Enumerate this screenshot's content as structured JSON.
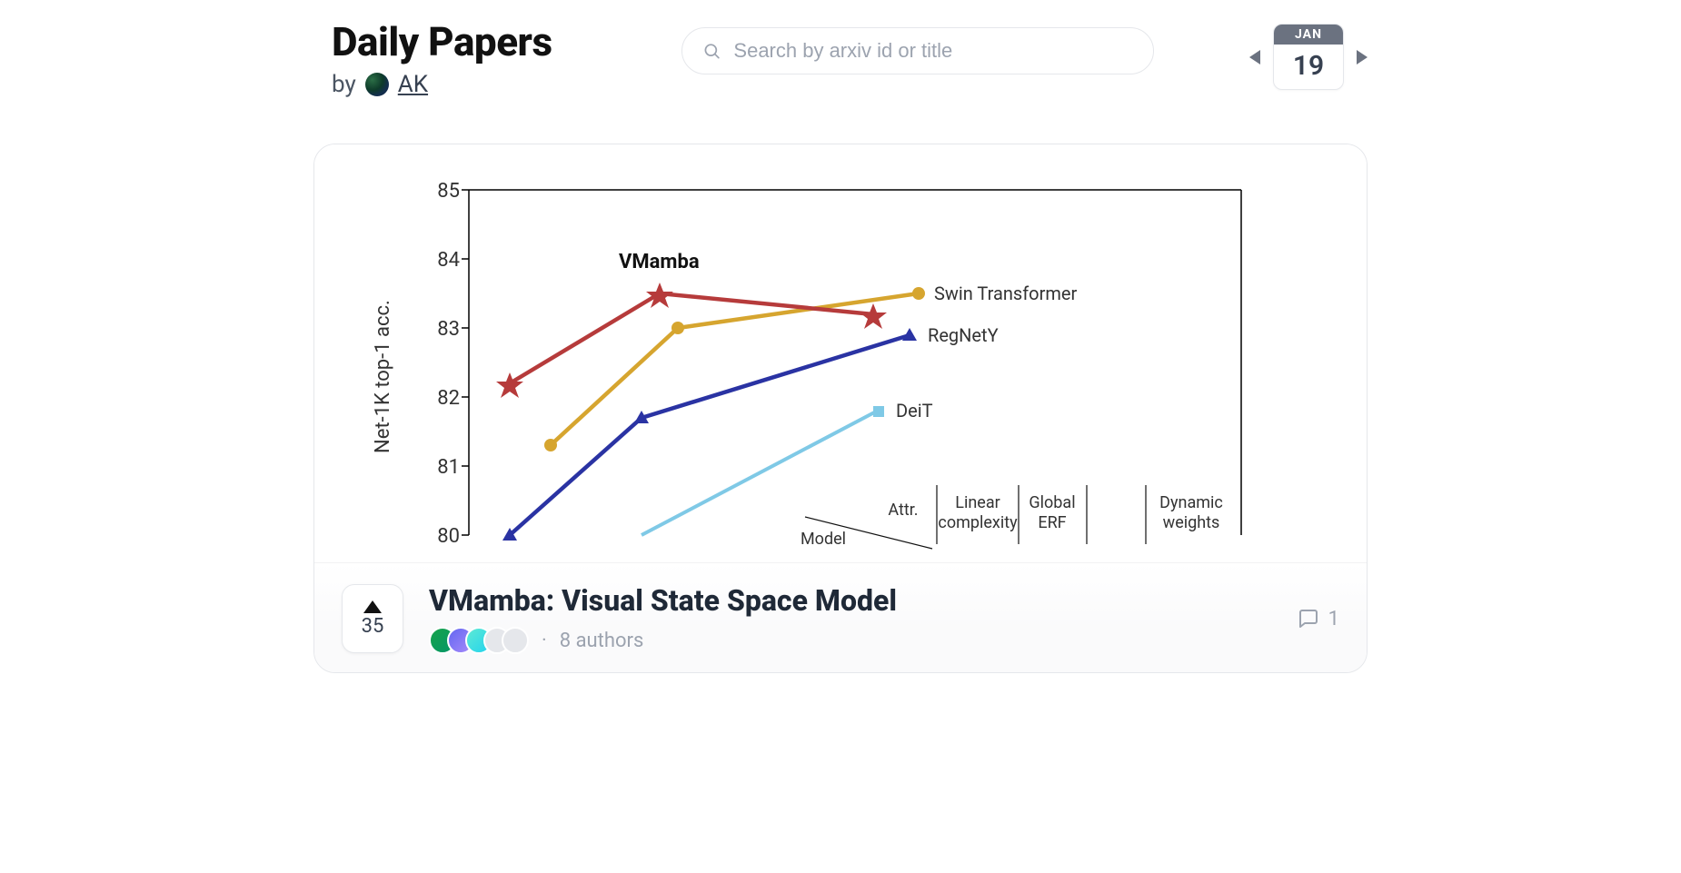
{
  "header": {
    "title": "Daily Papers",
    "by": "by",
    "author": "AK"
  },
  "search": {
    "placeholder": "Search by arxiv id or title"
  },
  "date": {
    "month": "JAN",
    "day": "19"
  },
  "paper": {
    "title": "VMamba: Visual State Space Model",
    "upvotes": "35",
    "authors_label": "8 authors",
    "dot": "·",
    "comments": "1"
  },
  "chart_data": {
    "type": "line",
    "title": "",
    "xlabel": "",
    "ylabel": "Net-1K top-1 acc.",
    "ylim": [
      80,
      85
    ],
    "yticks": [
      80,
      81,
      82,
      83,
      84,
      85
    ],
    "x_index": [
      0,
      1,
      2,
      3
    ],
    "series": [
      {
        "name": "VMamba",
        "marker": "star",
        "color": "#b63b3b",
        "values": [
          82.2,
          83.5,
          null,
          83.2
        ]
      },
      {
        "name": "Swin Transformer",
        "marker": "circle",
        "color": "#d6a52f",
        "values": [
          81.3,
          83.0,
          null,
          83.5
        ]
      },
      {
        "name": "RegNetY",
        "marker": "triangle",
        "color": "#2a33a3",
        "values": [
          80.0,
          81.7,
          null,
          82.9
        ]
      },
      {
        "name": "DeiT",
        "marker": "square",
        "color": "#7fc9e6",
        "values": [
          null,
          80.0,
          null,
          81.8
        ]
      }
    ],
    "table_headers": [
      "Model",
      "Attr.",
      "Linear complexity",
      "Global ERF",
      "Dynamic weights"
    ],
    "labels": {
      "vmamba": "VMamba",
      "swin": "Swin Transformer",
      "regnety": "RegNetY",
      "deit": "DeiT",
      "attr": "Attr.",
      "model": "Model",
      "linear": "Linear",
      "complexity": "complexity",
      "global": "Global",
      "erf": "ERF",
      "dynamic": "Dynamic",
      "weights": "weights",
      "t80": "80",
      "t81": "81",
      "t82": "82",
      "t83": "83",
      "t84": "84",
      "t85": "85"
    }
  }
}
